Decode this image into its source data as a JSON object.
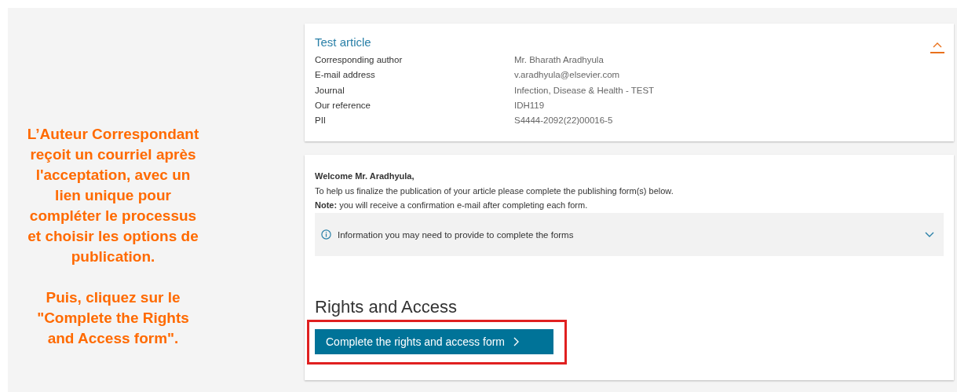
{
  "annotation": {
    "paragraphs": [
      "L’Auteur Correspondant reçoit un courriel après l'acceptation, avec un lien unique pour compléter le processus et choisir les options de publication.",
      "Puis, cliquez sur le \"Complete the Rights and Access form\"."
    ]
  },
  "article": {
    "title": "Test article",
    "expanded": true,
    "fields": [
      {
        "label": "Corresponding author",
        "value": "Mr. Bharath Aradhyula"
      },
      {
        "label": "E-mail address",
        "value": "v.aradhyula@elsevier.com"
      },
      {
        "label": "Journal",
        "value": "Infection, Disease & Health - TEST"
      },
      {
        "label": "Our reference",
        "value": "IDH119"
      },
      {
        "label": "PII",
        "value": "S4444-2092(22)00016-5"
      }
    ]
  },
  "welcome": {
    "greeting": "Welcome Mr. Aradhyula,",
    "intro": "To help us finalize the publication of your article please complete the publishing form(s) below.",
    "note": "**Note:** you will receive a confirmation e-mail after completing each form."
  },
  "info_panel": {
    "text": "Information you may need to provide to complete the forms",
    "expanded": false
  },
  "rights": {
    "heading": "Rights and Access",
    "button": "Complete the rights and access form",
    "highlighted": true
  }
}
